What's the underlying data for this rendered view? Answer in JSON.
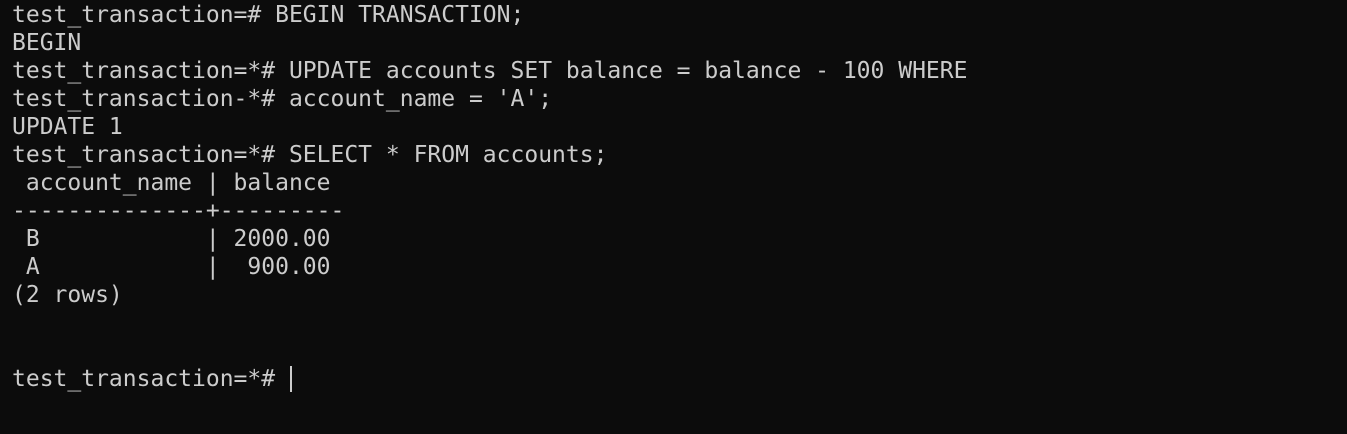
{
  "terminal": {
    "lines": [
      "test_transaction=# BEGIN TRANSACTION;",
      "BEGIN",
      "test_transaction=*# UPDATE accounts SET balance = balance - 100 WHERE",
      "test_transaction-*# account_name = 'A';",
      "UPDATE 1",
      "test_transaction=*# SELECT * FROM accounts;",
      " account_name | balance",
      "--------------+---------",
      " B            | 2000.00",
      " A            |  900.00",
      "(2 rows)"
    ],
    "current_prompt": "test_transaction=*# "
  },
  "colors": {
    "background": "#0c0c0c",
    "text": "#cccccc"
  }
}
